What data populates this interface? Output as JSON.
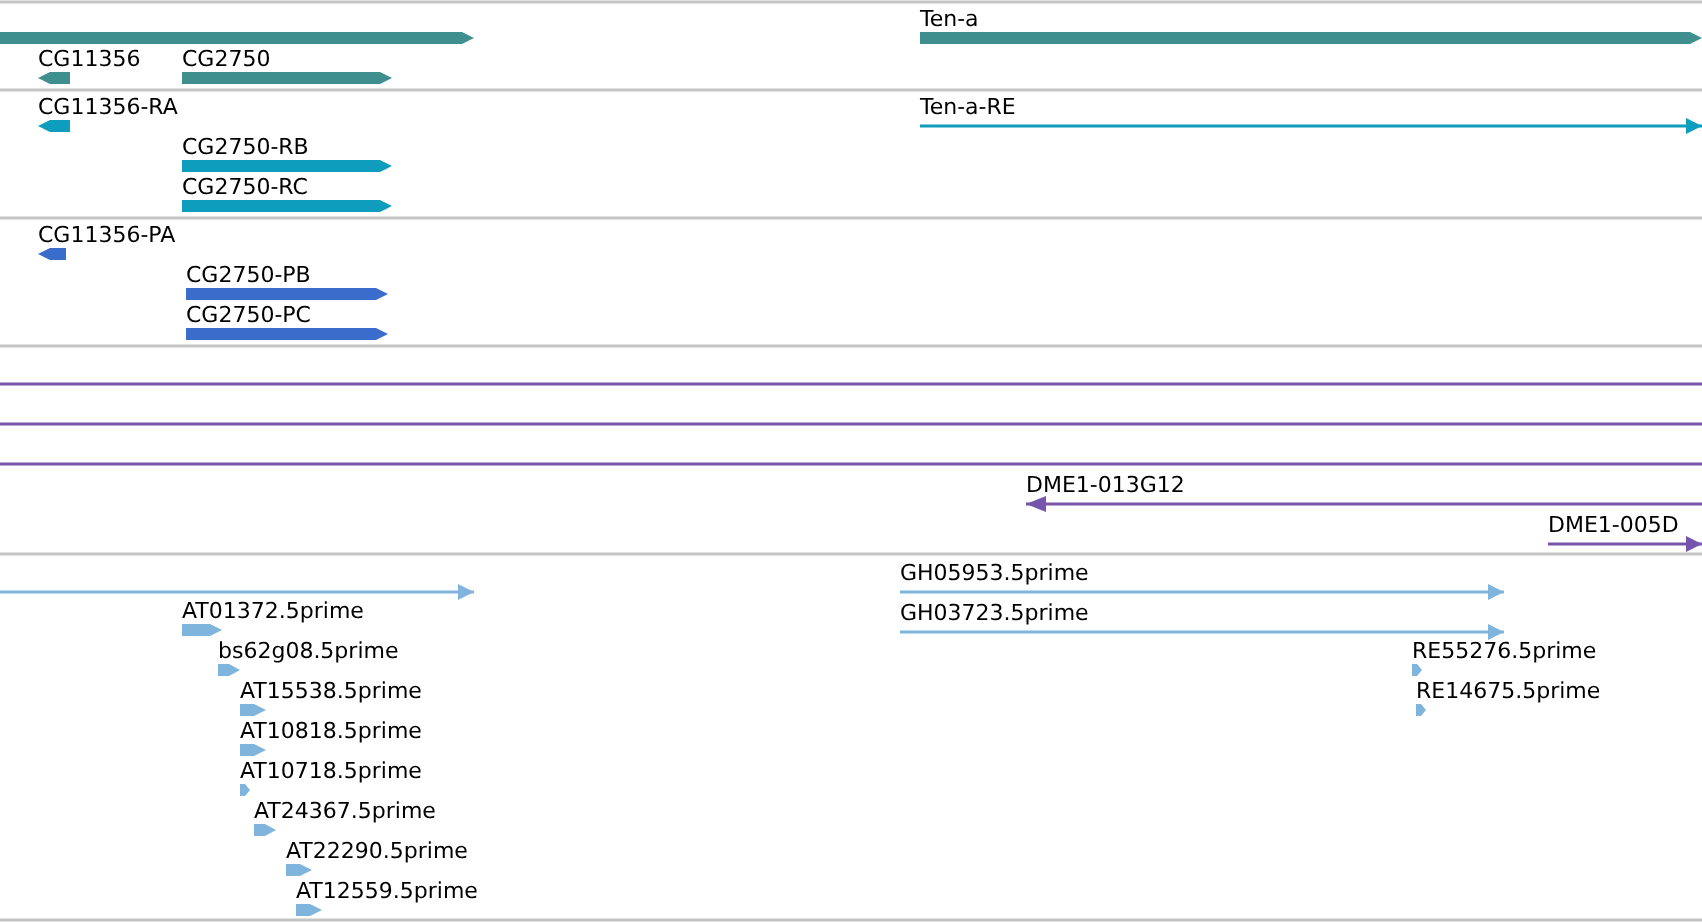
{
  "tracks": [
    {
      "color": "#3f8f8f",
      "features": [
        {
          "kind": "block",
          "reverse": false
        },
        {
          "label": "CG11356",
          "kind": "block",
          "reverse": true
        },
        {
          "label": "CG2750",
          "kind": "block",
          "reverse": false
        },
        {
          "label": "Ten-a",
          "kind": "block",
          "reverse": false
        }
      ]
    },
    {
      "color": "#0e9dbd",
      "features": [
        {
          "label": "CG11356-RA",
          "kind": "block",
          "reverse": true
        },
        {
          "label": "CG2750-RB",
          "kind": "block",
          "reverse": false
        },
        {
          "label": "CG2750-RC",
          "kind": "block",
          "reverse": false
        },
        {
          "label": "Ten-a-RE",
          "kind": "line",
          "reverse": false
        }
      ]
    },
    {
      "color": "#3a6ccc",
      "features": [
        {
          "label": "CG11356-PA",
          "kind": "block",
          "reverse": true
        },
        {
          "label": "CG2750-PB",
          "kind": "block",
          "reverse": false
        },
        {
          "label": "CG2750-PC",
          "kind": "block",
          "reverse": false
        }
      ]
    },
    {
      "color": "#7755aa",
      "features": [
        {
          "kind": "plain"
        },
        {
          "kind": "plain"
        },
        {
          "kind": "plain"
        },
        {
          "label": "DME1-013G12",
          "kind": "line",
          "reverse": true
        },
        {
          "label": "DME1-005D",
          "kind": "line",
          "reverse": false
        }
      ]
    },
    {
      "color": "#7fb5dd",
      "features": [
        {
          "kind": "line",
          "reverse": false
        },
        {
          "label": "AT01372.5prime",
          "kind": "block",
          "reverse": false
        },
        {
          "label": "bs62g08.5prime",
          "kind": "block",
          "reverse": false
        },
        {
          "label": "AT15538.5prime",
          "kind": "block",
          "reverse": false
        },
        {
          "label": "AT10818.5prime",
          "kind": "block",
          "reverse": false
        },
        {
          "label": "AT10718.5prime",
          "kind": "block",
          "reverse": false
        },
        {
          "label": "AT24367.5prime",
          "kind": "block",
          "reverse": false
        },
        {
          "label": "AT22290.5prime",
          "kind": "block",
          "reverse": false
        },
        {
          "label": "AT12559.5prime",
          "kind": "block",
          "reverse": false
        },
        {
          "label": "GH05953.5prime",
          "kind": "line",
          "reverse": false
        },
        {
          "label": "GH03723.5prime",
          "kind": "line",
          "reverse": false
        },
        {
          "label": "RE55276.5prime",
          "kind": "block",
          "reverse": false
        },
        {
          "label": "RE14675.5prime",
          "kind": "block",
          "reverse": false
        }
      ]
    }
  ]
}
